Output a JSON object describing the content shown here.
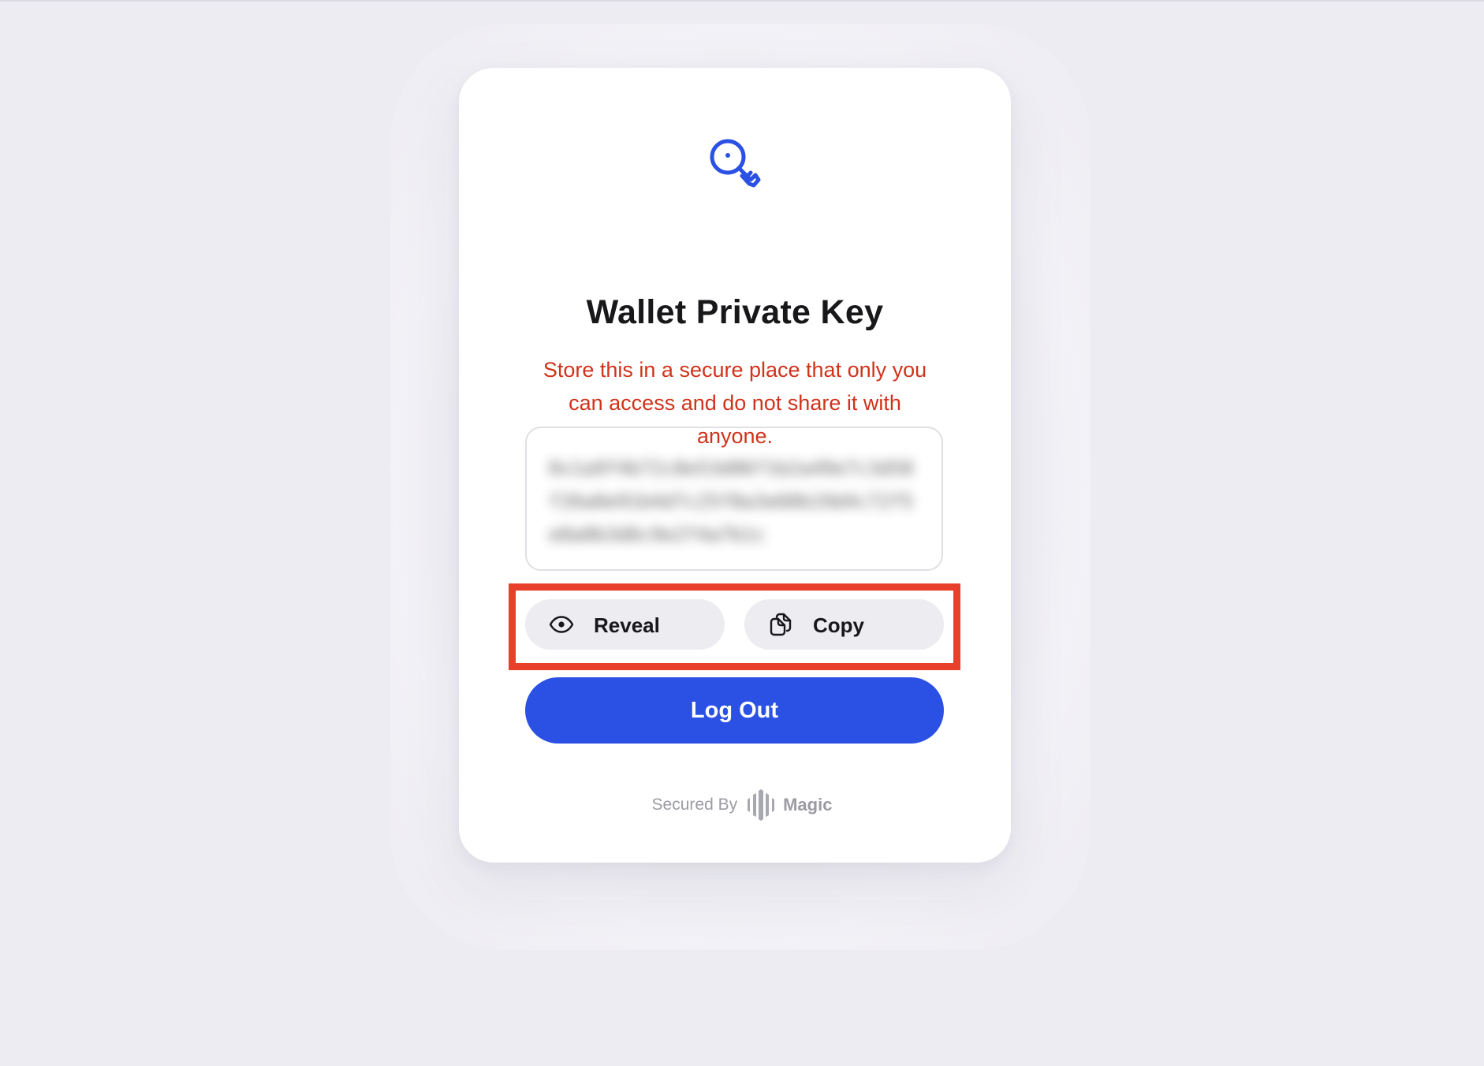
{
  "dialog": {
    "icon": "key-icon",
    "title": "Wallet Private Key",
    "warning": "Store this in a secure place that only you can access and do not share it with anyone.",
    "private_key": "0x1a9f4b72c8e53d06f1b2a49e7c3d58f26a0e91b4d7c25f8a3e60b19d4c72f5e8a0b3d6c9e2f4a7b1c",
    "actions": {
      "reveal": {
        "label": "Reveal",
        "icon": "eye-icon"
      },
      "copy": {
        "label": "Copy",
        "icon": "copy-icon"
      }
    },
    "logout_label": "Log Out",
    "footer": {
      "secured_by": "Secured By",
      "brand_icon": "magic-logo-icon",
      "brand_name": "Magic"
    }
  },
  "colors": {
    "background": "#edecf2",
    "card": "#ffffff",
    "accent": "#2b50e4",
    "warning": "#d0331b",
    "secondary_button": "#ececf1",
    "highlight_outline": "#e8402a"
  }
}
